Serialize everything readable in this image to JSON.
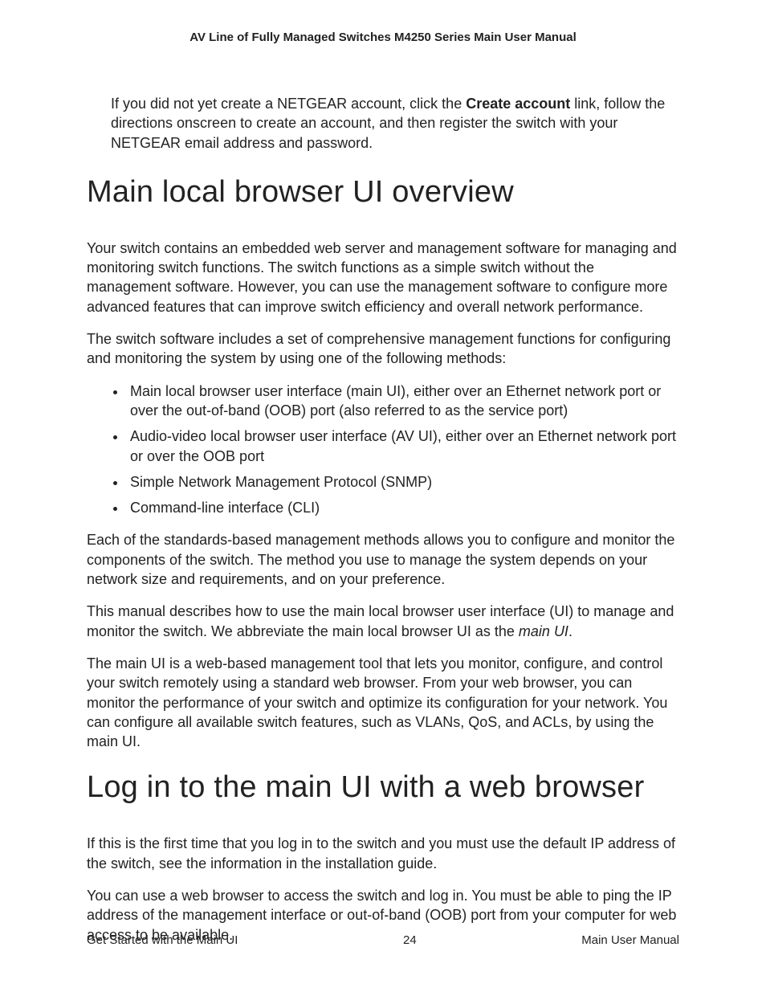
{
  "header": {
    "title": "AV Line of Fully Managed Switches M4250 Series Main User Manual"
  },
  "intro": {
    "pre": "If you did not yet create a NETGEAR account, click the ",
    "bold": "Create account",
    "post": " link, follow the directions onscreen to create an account, and then register the switch with your NETGEAR email address and password."
  },
  "section1": {
    "heading": "Main local browser UI overview",
    "p1": "Your switch contains an embedded web server and management software for managing and monitoring switch functions. The switch functions as a simple switch without the management software. However, you can use the management software to configure more advanced features that can improve switch efficiency and overall network performance.",
    "p2": "The switch software includes a set of comprehensive management functions for configuring and monitoring the system by using one of the following methods:",
    "bullets": [
      "Main local browser user interface (main UI), either over an Ethernet network port or over the out-of-band (OOB) port (also referred to as the service port)",
      "Audio-video local browser user interface (AV UI), either over an Ethernet network port or over the OOB port",
      "Simple Network Management Protocol (SNMP)",
      "Command-line interface (CLI)"
    ],
    "p3": "Each of the standards-based management methods allows you to configure and monitor the components of the switch. The method you use to manage the system depends on your network size and requirements, and on your preference.",
    "p4_pre": "This manual describes how to use the main local browser user interface (UI) to manage and monitor the switch. We abbreviate the main local browser UI as the ",
    "p4_italic": "main UI",
    "p4_post": ".",
    "p5": "The main UI is a web-based management tool that lets you monitor, configure, and control your switch remotely using a standard web browser. From your web browser, you can monitor the performance of your switch and optimize its configuration for your network. You can configure all available switch features, such as VLANs, QoS, and ACLs, by using the main UI."
  },
  "section2": {
    "heading": "Log in to the main UI with a web browser",
    "p1": "If this is the first time that you log in to the switch and you must use the default IP address of the switch, see the information in the installation guide.",
    "p2": "You can use a web browser to access the switch and log in. You must be able to ping the IP address of the management interface or out-of-band (OOB) port from your computer for web access to be available."
  },
  "footer": {
    "left": "Get Started with the Main UI",
    "center": "24",
    "right": "Main User Manual"
  }
}
